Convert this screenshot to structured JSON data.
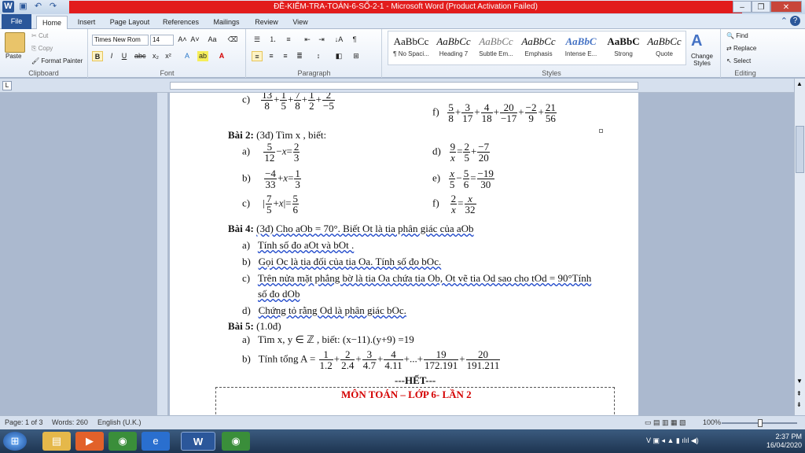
{
  "window": {
    "title": "ĐỀ-KIỂM-TRA-TOÁN-6-SỐ-2-1  -  Microsoft Word (Product Activation Failed)"
  },
  "tabs": [
    "File",
    "Home",
    "Insert",
    "Page Layout",
    "References",
    "Mailings",
    "Review",
    "View"
  ],
  "ribbon": {
    "clipboard": {
      "paste": "Paste",
      "cut": "Cut",
      "copy": "Copy",
      "format_painter": "Format Painter",
      "label": "Clipboard"
    },
    "font": {
      "name": "Times New Rom",
      "size": "14",
      "label": "Font"
    },
    "paragraph": {
      "label": "Paragraph"
    },
    "styles": {
      "label": "Styles",
      "items": [
        {
          "sample": "AaBbCc",
          "name": "¶ No Spaci..."
        },
        {
          "sample": "AaBbCc",
          "name": "Heading 7"
        },
        {
          "sample": "AaBbCc",
          "name": "Subtle Em..."
        },
        {
          "sample": "AaBbCc",
          "name": "Emphasis"
        },
        {
          "sample": "AaBbC",
          "name": "Intense E..."
        },
        {
          "sample": "AaBbC",
          "name": "Strong"
        },
        {
          "sample": "AaBbCc",
          "name": "Quote"
        }
      ],
      "change_styles": "Change Styles"
    },
    "editing": {
      "find": "Find",
      "replace": "Replace",
      "select": "Select",
      "label": "Editing"
    }
  },
  "document": {
    "line_c_label": "c)",
    "line_f_label": "f)",
    "bai2_title": "Bài 2:",
    "bai2_text": "(3đ)  Tìm  x , biết:",
    "bai4_title": "Bài 4:",
    "bai4_text": "(3đ) Cho aOb = 70°. Biết Ot là tia phân giác của aOb",
    "bai4_a": "Tính số đo aOt và bOt .",
    "bai4_b": "Gọi Oc là tia đối của tia Oa. Tính số đo bOc.",
    "bai4_c": "Trên nửa mặt phẳng bờ là tia Oa chứa tia Ob, Ot vẽ tia Od sao cho  tOd = 90°Tính",
    "bai4_c2": "số đo dOb",
    "bai4_d": "Chứng tỏ rằng Od là phân giác  bOc.",
    "bai5_title": "Bài 5:",
    "bai5_text": "(1.0đ)",
    "bai5_a": "Tìm  x, y ∈ ℤ , biết:   (x−11).(y+9) =19",
    "bai5_b_prefix": "Tính tổng A =",
    "het": "---HẾT---",
    "footer_heading": "MÔN TOÁN – LỚP 6- LẦN 2"
  },
  "status": {
    "page": "Page: 1 of 3",
    "words": "Words: 260",
    "language": "English (U.K.)",
    "zoom": "100%"
  },
  "tray": {
    "time": "2:37 PM",
    "date": "16/04/2020"
  },
  "colors": {
    "accent": "#2b579a",
    "title_red": "#e21c1c",
    "heading_red": "#d40000"
  }
}
